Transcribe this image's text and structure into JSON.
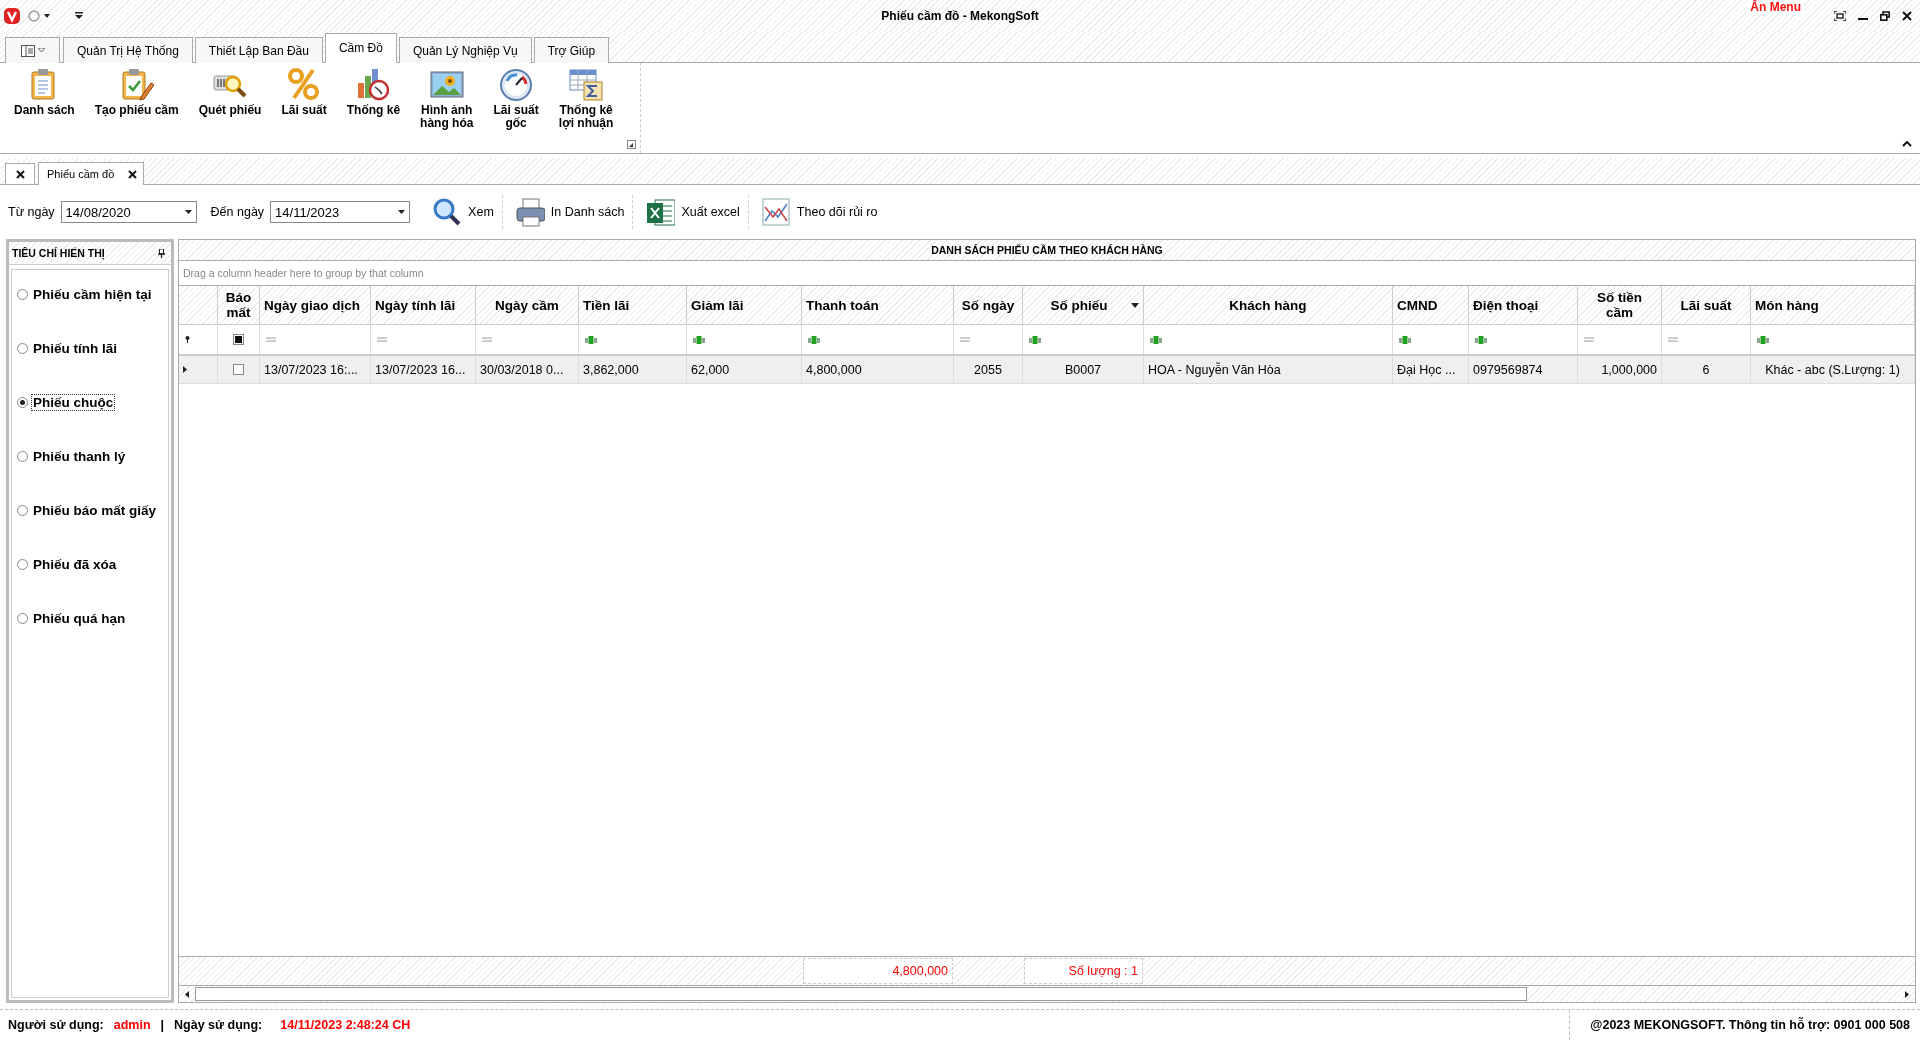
{
  "window": {
    "title": "Phiếu cầm đồ - MekongSoft",
    "hide_menu": "Ẩn Menu"
  },
  "ribbon": {
    "tabs": [
      {
        "label": "Quản Trị Hệ Thống",
        "selected": false
      },
      {
        "label": "Thiết Lập Ban Đầu",
        "selected": false
      },
      {
        "label": "Cầm Đồ",
        "selected": true
      },
      {
        "label": "Quản Lý Nghiệp Vụ",
        "selected": false
      },
      {
        "label": "Trợ Giúp",
        "selected": false
      }
    ],
    "buttons": [
      "Danh sách",
      "Tạo phiếu cầm",
      "Quét phiếu",
      "Lãi suất",
      "Thống kê",
      "Hình ảnh\nhàng hóa",
      "Lãi suất\ngốc",
      "Thống kê\nlợi nhuận"
    ]
  },
  "document_tabs": [
    {
      "label": "Phiếu cầm đồ",
      "selected": true
    }
  ],
  "toolbar": {
    "from_label": "Từ ngày",
    "from_value": "14/08/2020",
    "to_label": "Đến ngày",
    "to_value": "14/11/2023",
    "buttons": [
      "Xem",
      "In Danh sách",
      "Xuất excel",
      "Theo dõi rủi ro"
    ]
  },
  "criteria_panel": {
    "title": "TIÊU CHÍ HIỂN THỊ",
    "options": [
      {
        "label": "Phiếu cầm hiện tại",
        "selected": false
      },
      {
        "label": "Phiếu tính lãi",
        "selected": false
      },
      {
        "label": "Phiếu chuộc",
        "selected": true
      },
      {
        "label": "Phiếu thanh lý",
        "selected": false
      },
      {
        "label": "Phiếu báo mất giấy",
        "selected": false
      },
      {
        "label": "Phiếu đã xóa",
        "selected": false
      },
      {
        "label": "Phiếu quá hạn",
        "selected": false
      }
    ]
  },
  "grid": {
    "title": "DANH SÁCH PHIẾU CẦM THEO KHÁCH HÀNG",
    "group_hint": "Drag a column header here to group by that column",
    "columns": [
      {
        "label": "Báo mất",
        "filter": {
          "kind": "checkbox",
          "indeterminate": true
        }
      },
      {
        "label": "Ngày giao dịch",
        "filter": {
          "kind": "equals"
        }
      },
      {
        "label": "Ngày tính lãi",
        "filter": {
          "kind": "equals"
        }
      },
      {
        "label": "Ngày cầm",
        "filter": {
          "kind": "equals"
        }
      },
      {
        "label": "Tiền lãi",
        "filter": {
          "kind": "text"
        }
      },
      {
        "label": "Giảm lãi",
        "filter": {
          "kind": "text"
        }
      },
      {
        "label": "Thanh toán",
        "filter": {
          "kind": "text"
        },
        "summary": "4,800,000"
      },
      {
        "label": "Số ngày",
        "filter": {
          "kind": "equals"
        }
      },
      {
        "label": "Số phiếu",
        "filter": {
          "kind": "text"
        },
        "sorted_descending": true,
        "summary": "Số lượng : 1"
      },
      {
        "label": "Khách hàng",
        "filter": {
          "kind": "text"
        }
      },
      {
        "label": "CMND",
        "filter": {
          "kind": "text"
        }
      },
      {
        "label": "Điện thoại",
        "filter": {
          "kind": "text"
        }
      },
      {
        "label": "Số tiền cầm",
        "filter": {
          "kind": "equals"
        }
      },
      {
        "label": "Lãi suất",
        "filter": {
          "kind": "equals"
        }
      },
      {
        "label": "Món hàng",
        "filter": {
          "kind": "text"
        }
      }
    ],
    "rows": [
      {
        "selected": true,
        "lost": false,
        "cells": [
          "",
          "13/07/2023 16:...",
          "13/07/2023 16...",
          "30/03/2018 0...",
          "3,862,000",
          "62,000",
          "4,800,000",
          "2055",
          "B0007",
          "HOA - Nguyễn Văn Hòa",
          "Đại Học ...",
          "0979569874",
          "1,000,000",
          "6",
          "Khác - abc (S.Lượng: 1)"
        ]
      }
    ]
  },
  "status_bar": {
    "user_label": "Người sử dụng:",
    "user": "admin",
    "separator": "|",
    "date_label": "Ngày sử dụng:",
    "date": "14/11/2023 2:48:24 CH",
    "copyright": "@2023 MEKONGSOFT. Thông tin hỗ trợ: 0901 000 508"
  }
}
